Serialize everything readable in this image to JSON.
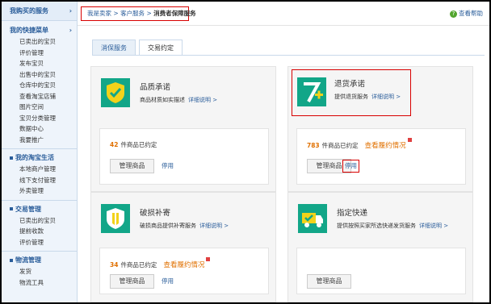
{
  "sidebar": {
    "top": "我购买的服务",
    "quick_menu": {
      "title": "我的快捷菜单",
      "items": [
        "已卖出的宝贝",
        "评价管理",
        "发布宝贝",
        "出售中的宝贝",
        "仓库中的宝贝",
        "查看淘宝店铺",
        "图片空间",
        "宝贝分类管理",
        "数据中心",
        "我要推广"
      ]
    },
    "groups": [
      {
        "title": "我的淘宝生活",
        "items": [
          "本地商户管理",
          "线下支付管理",
          "外卖管理"
        ]
      },
      {
        "title": "交易管理",
        "items": [
          "已卖出的宝贝",
          "提前收款",
          "评价管理"
        ]
      },
      {
        "title": "物流管理",
        "items": [
          "发货",
          "物流工具"
        ]
      }
    ]
  },
  "breadcrumb": {
    "home": "我是卖家",
    "sep1": " > ",
    "section": "客户服务",
    "sep2": " > ",
    "current": "消费者保障服务"
  },
  "help": {
    "label": "查看帮助"
  },
  "tabs": [
    "消保服务",
    "交易约定"
  ],
  "cards": [
    {
      "title": "品质承诺",
      "desc": "商品材质如实描述",
      "link": "详细说明 >",
      "count": "42",
      "count_suffix": "件商品已约定",
      "perf": "",
      "manage": "管理商品",
      "stop": "停用"
    },
    {
      "title": "退货承诺",
      "desc": "提供退货服务",
      "link": "详细说明 >",
      "count": "783",
      "count_suffix": "件商品已约定",
      "perf": "查看履约情况",
      "manage": "管理商品",
      "stop": "停用"
    },
    {
      "title": "破损补寄",
      "desc": "破损商品提供补寄服务",
      "link": "详细说明 >",
      "count": "34",
      "count_suffix": "件商品已约定",
      "perf": "查看履约情况",
      "manage": "管理商品",
      "stop": "停用"
    },
    {
      "title": "指定快递",
      "desc": "提供按照买家所选快递发货服务",
      "link": "详细说明 >",
      "count": "",
      "count_suffix": "",
      "perf": "",
      "manage": "管理商品",
      "stop": ""
    }
  ]
}
